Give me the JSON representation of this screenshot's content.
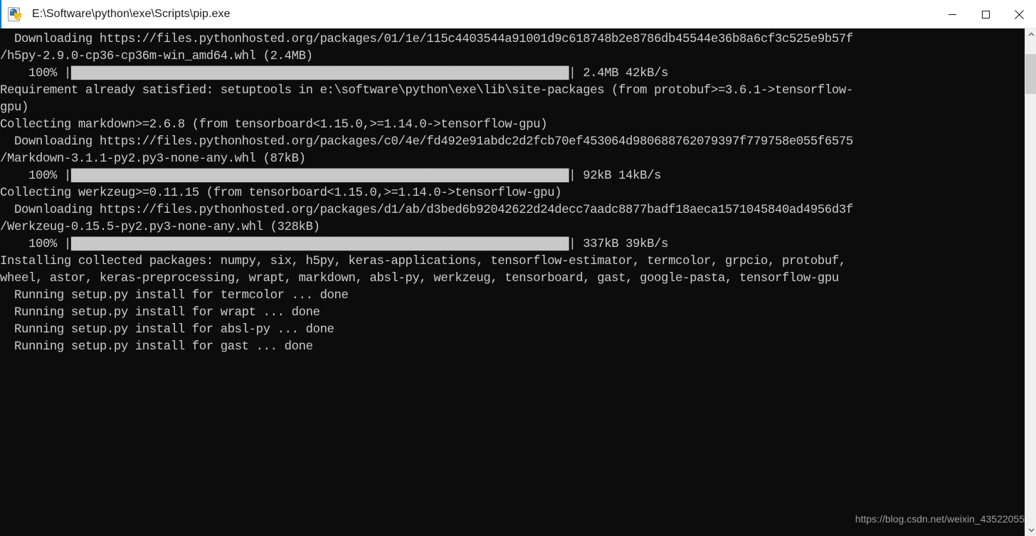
{
  "window": {
    "title": "E:\\Software\\python\\exe\\Scripts\\pip.exe",
    "icon": "python-file-icon",
    "background_color": "#0c0c0c",
    "titlebar_color": "#ffffff",
    "controls": {
      "minimize_label": "—",
      "maximize_label": "□",
      "close_label": "✕"
    }
  },
  "console": {
    "foreground_color": "#cccccc",
    "background_color": "#0c0c0c",
    "lines": [
      "  Downloading https://files.pythonhosted.org/packages/01/1e/115c4403544a91001d9c618748b2e8786db45544e36b8a6cf3c525e9b57f",
      "/h5py-2.9.0-cp36-cp36m-win_amd64.whl (2.4MB)",
      "    100% |██████████████████████████████████████████████████████████████████████| 2.4MB 42kB/s",
      "Requirement already satisfied: setuptools in e:\\software\\python\\exe\\lib\\site-packages (from protobuf>=3.6.1->tensorflow-",
      "gpu)",
      "Collecting markdown>=2.6.8 (from tensorboard<1.15.0,>=1.14.0->tensorflow-gpu)",
      "  Downloading https://files.pythonhosted.org/packages/c0/4e/fd492e91abdc2d2fcb70ef453064d980688762079397f779758e055f6575",
      "/Markdown-3.1.1-py2.py3-none-any.whl (87kB)",
      "    100% |██████████████████████████████████████████████████████████████████████| 92kB 14kB/s",
      "Collecting werkzeug>=0.11.15 (from tensorboard<1.15.0,>=1.14.0->tensorflow-gpu)",
      "  Downloading https://files.pythonhosted.org/packages/d1/ab/d3bed6b92042622d24decc7aadc8877badf18aeca1571045840ad4956d3f",
      "/Werkzeug-0.15.5-py2.py3-none-any.whl (328kB)",
      "    100% |██████████████████████████████████████████████████████████████████████| 337kB 39kB/s",
      "Installing collected packages: numpy, six, h5py, keras-applications, tensorflow-estimator, termcolor, grpcio, protobuf,",
      "wheel, astor, keras-preprocessing, wrapt, markdown, absl-py, werkzeug, tensorboard, gast, google-pasta, tensorflow-gpu",
      "  Running setup.py install for termcolor ... done",
      "  Running setup.py install for wrapt ... done",
      "  Running setup.py install for absl-py ... done",
      "  Running setup.py install for gast ... done"
    ]
  },
  "scrollbar": {
    "up_arrow": "scroll-up-arrow",
    "down_arrow": "scroll-down-arrow",
    "track_color": "#f0f0f0",
    "thumb_color": "#cdcdcd"
  },
  "watermark": {
    "text": "https://blog.csdn.net/weixin_43522055"
  }
}
